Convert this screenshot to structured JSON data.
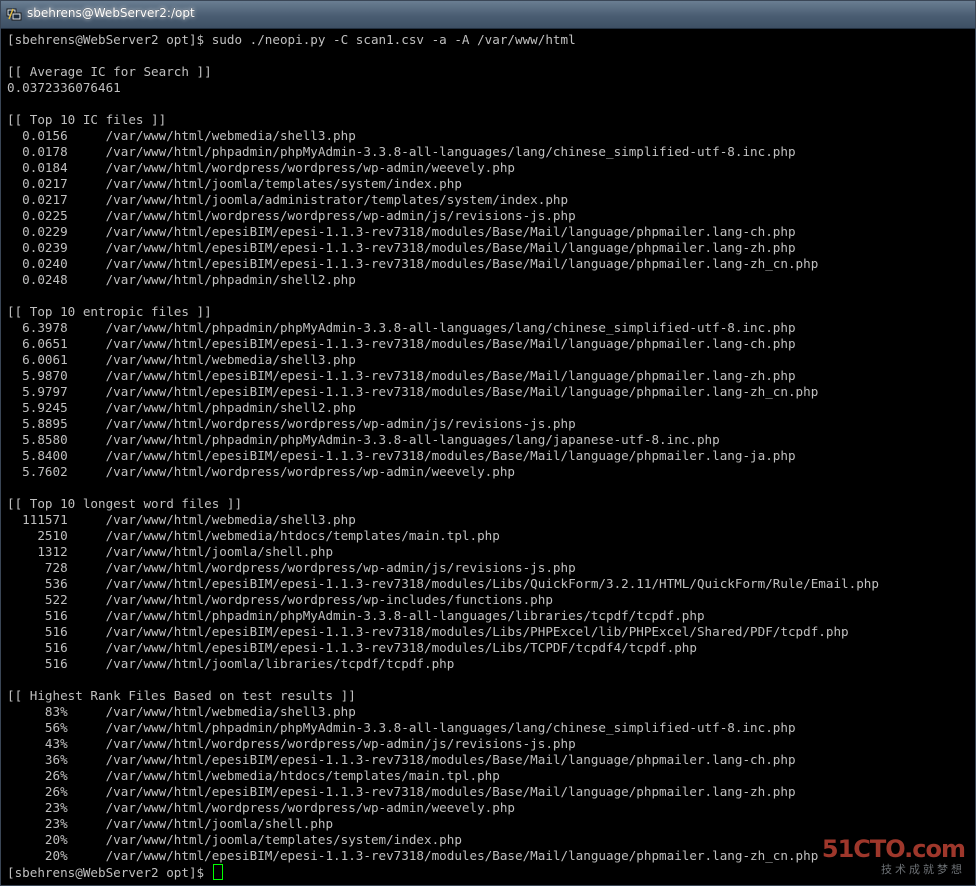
{
  "window": {
    "title": "sbehrens@WebServer2:/opt"
  },
  "terminal": {
    "lines": [
      "[sbehrens@WebServer2 opt]$ sudo ./neopi.py -C scan1.csv -a -A /var/www/html",
      "",
      "[[ Average IC for Search ]]",
      "0.0372336076461",
      "",
      "[[ Top 10 IC files ]]",
      "  0.0156     /var/www/html/webmedia/shell3.php",
      "  0.0178     /var/www/html/phpadmin/phpMyAdmin-3.3.8-all-languages/lang/chinese_simplified-utf-8.inc.php",
      "  0.0184     /var/www/html/wordpress/wordpress/wp-admin/weevely.php",
      "  0.0217     /var/www/html/joomla/templates/system/index.php",
      "  0.0217     /var/www/html/joomla/administrator/templates/system/index.php",
      "  0.0225     /var/www/html/wordpress/wordpress/wp-admin/js/revisions-js.php",
      "  0.0229     /var/www/html/epesiBIM/epesi-1.1.3-rev7318/modules/Base/Mail/language/phpmailer.lang-ch.php",
      "  0.0239     /var/www/html/epesiBIM/epesi-1.1.3-rev7318/modules/Base/Mail/language/phpmailer.lang-zh.php",
      "  0.0240     /var/www/html/epesiBIM/epesi-1.1.3-rev7318/modules/Base/Mail/language/phpmailer.lang-zh_cn.php",
      "  0.0248     /var/www/html/phpadmin/shell2.php",
      "",
      "[[ Top 10 entropic files ]]",
      "  6.3978     /var/www/html/phpadmin/phpMyAdmin-3.3.8-all-languages/lang/chinese_simplified-utf-8.inc.php",
      "  6.0651     /var/www/html/epesiBIM/epesi-1.1.3-rev7318/modules/Base/Mail/language/phpmailer.lang-ch.php",
      "  6.0061     /var/www/html/webmedia/shell3.php",
      "  5.9870     /var/www/html/epesiBIM/epesi-1.1.3-rev7318/modules/Base/Mail/language/phpmailer.lang-zh.php",
      "  5.9797     /var/www/html/epesiBIM/epesi-1.1.3-rev7318/modules/Base/Mail/language/phpmailer.lang-zh_cn.php",
      "  5.9245     /var/www/html/phpadmin/shell2.php",
      "  5.8895     /var/www/html/wordpress/wordpress/wp-admin/js/revisions-js.php",
      "  5.8580     /var/www/html/phpadmin/phpMyAdmin-3.3.8-all-languages/lang/japanese-utf-8.inc.php",
      "  5.8400     /var/www/html/epesiBIM/epesi-1.1.3-rev7318/modules/Base/Mail/language/phpmailer.lang-ja.php",
      "  5.7602     /var/www/html/wordpress/wordpress/wp-admin/weevely.php",
      "",
      "[[ Top 10 longest word files ]]",
      "  111571     /var/www/html/webmedia/shell3.php",
      "    2510     /var/www/html/webmedia/htdocs/templates/main.tpl.php",
      "    1312     /var/www/html/joomla/shell.php",
      "     728     /var/www/html/wordpress/wordpress/wp-admin/js/revisions-js.php",
      "     536     /var/www/html/epesiBIM/epesi-1.1.3-rev7318/modules/Libs/QuickForm/3.2.11/HTML/QuickForm/Rule/Email.php",
      "     522     /var/www/html/wordpress/wordpress/wp-includes/functions.php",
      "     516     /var/www/html/phpadmin/phpMyAdmin-3.3.8-all-languages/libraries/tcpdf/tcpdf.php",
      "     516     /var/www/html/epesiBIM/epesi-1.1.3-rev7318/modules/Libs/PHPExcel/lib/PHPExcel/Shared/PDF/tcpdf.php",
      "     516     /var/www/html/epesiBIM/epesi-1.1.3-rev7318/modules/Libs/TCPDF/tcpdf4/tcpdf.php",
      "     516     /var/www/html/joomla/libraries/tcpdf/tcpdf.php",
      "",
      "[[ Highest Rank Files Based on test results ]]",
      "     83%     /var/www/html/webmedia/shell3.php",
      "     56%     /var/www/html/phpadmin/phpMyAdmin-3.3.8-all-languages/lang/chinese_simplified-utf-8.inc.php",
      "     43%     /var/www/html/wordpress/wordpress/wp-admin/js/revisions-js.php",
      "     36%     /var/www/html/epesiBIM/epesi-1.1.3-rev7318/modules/Base/Mail/language/phpmailer.lang-ch.php",
      "     26%     /var/www/html/webmedia/htdocs/templates/main.tpl.php",
      "     26%     /var/www/html/epesiBIM/epesi-1.1.3-rev7318/modules/Base/Mail/language/phpmailer.lang-zh.php",
      "     23%     /var/www/html/wordpress/wordpress/wp-admin/weevely.php",
      "     23%     /var/www/html/joomla/shell.php",
      "     20%     /var/www/html/joomla/templates/system/index.php",
      "     20%     /var/www/html/epesiBIM/epesi-1.1.3-rev7318/modules/Base/Mail/language/phpmailer.lang-zh_cn.php"
    ],
    "prompt": "[sbehrens@WebServer2 opt]$ ",
    "cursor_color": "#00ff00",
    "text_color": "#c0c0c0",
    "background": "#000000"
  },
  "watermark": {
    "main": "51CTO.com",
    "sub": "技术成就梦想"
  }
}
